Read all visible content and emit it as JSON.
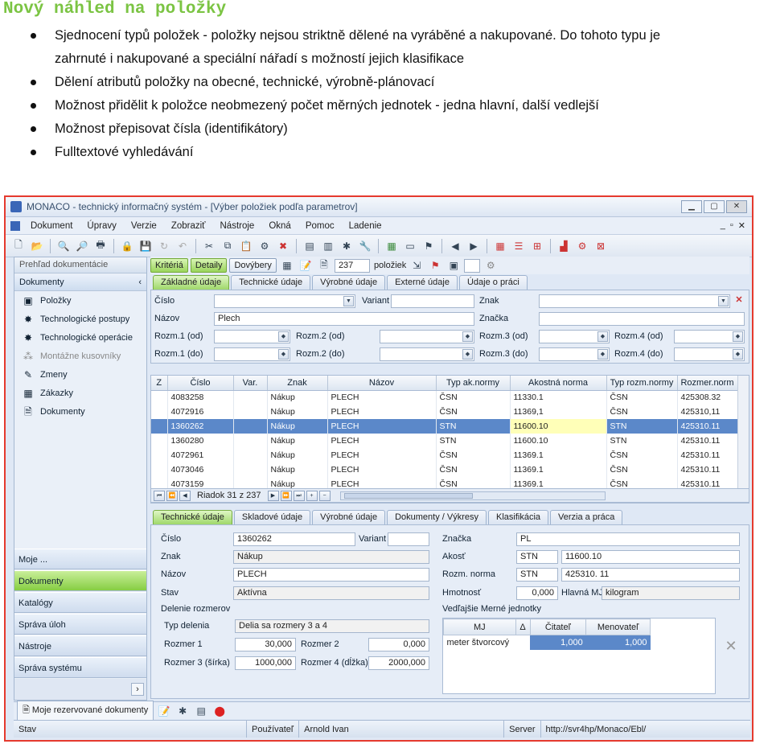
{
  "slide": {
    "title": "Nový náhled na položky",
    "bullets": [
      [
        "Sjednocení typů položek  - položky nejsou striktně dělené na vyráběné a nakupované. Do tohoto  typu je",
        "zahrnuté i nakupované a speciální nářadí s možností jejich klasifikace"
      ],
      [
        "Dělení atributů položky na obecné, technické, výrobně-plánovací"
      ],
      [
        "Možnost přidělit k položce neobmezený počet měrných jednotek  - jedna hlavní, další vedlejší"
      ],
      [
        "Možnost přepisovat čísla (identifikátory)"
      ],
      [
        "Fulltextové vyhledávání"
      ]
    ]
  },
  "window": {
    "title": "MONACO - technický informačný systém - [Výber položiek podľa parametrov]",
    "menu": [
      "Dokument",
      "Úpravy",
      "Verzie",
      "Zobraziť",
      "Nástroje",
      "Okná",
      "Pomoc",
      "Ladenie"
    ],
    "menu_right": [
      "_",
      "▫",
      "✕"
    ]
  },
  "left": {
    "header": "Prehľad dokumentácie",
    "section": "Dokumenty",
    "items": [
      {
        "label": "Položky",
        "icon": "item-icon"
      },
      {
        "label": "Technologické postupy",
        "icon": "gears-icon"
      },
      {
        "label": "Technologické operácie",
        "icon": "gears-icon"
      },
      {
        "label": "Montážne kusovníky",
        "icon": "assembly-icon"
      },
      {
        "label": "Zmeny",
        "icon": "change-icon"
      },
      {
        "label": "Zákazky",
        "icon": "order-icon"
      },
      {
        "label": "Dokumenty",
        "icon": "document-icon"
      }
    ],
    "nav": [
      "Moje ...",
      "Dokumenty",
      "Katalógy",
      "Správa úloh",
      "Nástroje",
      "Správa systému"
    ]
  },
  "topbar": {
    "kriteria": "Kritériá",
    "detaily": "Detaily",
    "dovybery": "Dovýbery",
    "count": "237",
    "count_label": "položiek"
  },
  "filter_tabs": [
    "Základné údaje",
    "Technické údaje",
    "Výrobné údaje",
    "Externé údaje",
    "Údaje o práci"
  ],
  "filter": {
    "cislo": "Číslo",
    "variant": "Variant",
    "znak": "Znak",
    "nazov": "Názov",
    "nazov_value": "Plech",
    "znacka": "Značka",
    "rozm1od": "Rozm.1 (od)",
    "rozm2od": "Rozm.2 (od)",
    "rozm3od": "Rozm.3 (od)",
    "rozm4od": "Rozm.4 (od)",
    "rozm1do": "Rozm.1 (do)",
    "rozm2do": "Rozm.2 (do)",
    "rozm3do": "Rozm.3 (do)",
    "rozm4do": "Rozm.4 (do)"
  },
  "grid": {
    "columns": [
      "Z",
      "Číslo",
      "Var.",
      "Znak",
      "Názov",
      "Typ ak.normy",
      "Akostná norma",
      "Typ rozm.normy",
      "Rozmer.norm"
    ],
    "rows": [
      [
        "",
        "4083258",
        "",
        "Nákup",
        "PLECH",
        "ČSN",
        "11330.1",
        "ČSN",
        "425308.32"
      ],
      [
        "",
        "4072916",
        "",
        "Nákup",
        "PLECH",
        "ČSN",
        "11369,1",
        "ČSN",
        "425310,11"
      ],
      [
        "",
        "1360262",
        "",
        "Nákup",
        "PLECH",
        "STN",
        "11600.10",
        "STN",
        "425310.11"
      ],
      [
        "",
        "1360280",
        "",
        "Nákup",
        "PLECH",
        "STN",
        "11600.10",
        "STN",
        "425310.11"
      ],
      [
        "",
        "4072961",
        "",
        "Nákup",
        "PLECH",
        "ČSN",
        "11369.1",
        "ČSN",
        "425310.11"
      ],
      [
        "",
        "4073046",
        "",
        "Nákup",
        "PLECH",
        "ČSN",
        "11369.1",
        "ČSN",
        "425310.11"
      ],
      [
        "",
        "4073159",
        "",
        "Nákup",
        "PLECH",
        "ČSN",
        "11369.1",
        "ČSN",
        "425310.11"
      ]
    ],
    "selected_index": 2,
    "nav_text": "Riadok 31 z 237"
  },
  "detail_tabs": [
    "Technické údaje",
    "Skladové údaje",
    "Výrobné údaje",
    "Dokumenty / Výkresy",
    "Klasifikácia",
    "Verzia a práca"
  ],
  "detail": {
    "cislo_l": "Číslo",
    "cislo": "1360262",
    "variant_l": "Variant",
    "znak_l": "Znak",
    "znak": "Nákup",
    "nazov_l": "Názov",
    "nazov": "PLECH",
    "stav_l": "Stav",
    "stav": "Aktívna",
    "delenie": "Delenie rozmerov",
    "typ_l": "Typ delenia",
    "typ": "Delia sa rozmery 3 a 4",
    "r1_l": "Rozmer 1",
    "r1": "30,000",
    "r2_l": "Rozmer 2",
    "r2": "0,000",
    "r3_l": "Rozmer 3 (šírka)",
    "r3": "1000,000",
    "r4_l": "Rozmer 4 (dĺžka)",
    "r4": "2000,000",
    "znacka_l": "Značka",
    "znacka": "PL",
    "akost_l": "Akosť",
    "akost1": "STN",
    "akost2": "11600.10",
    "rozm_l": "Rozm. norma",
    "rozm1": "STN",
    "rozm2": "425310. 11",
    "hmot_l": "Hmotnosť",
    "hmot": "0,000",
    "hmj_l": "Hlavná MJ",
    "hmj": "kilogram",
    "vmj": "Vedľajšie Merné jednotky",
    "mj_cols": [
      "MJ",
      "Δ",
      "Čitateľ",
      "Menovateľ"
    ],
    "mj_row": [
      "meter štvorcový",
      "1,000",
      "1,000"
    ]
  },
  "bottom": {
    "tab": "Moje rezervované dokumenty"
  },
  "status": {
    "stav": "Stav",
    "pouzivatel_l": "Používateľ",
    "pouzivatel": "Arnold Ivan",
    "server_l": "Server",
    "server": "http://svr4hp/Monaco/Ebl/"
  },
  "colors": {
    "title_green": "#7bc443",
    "frame_red": "#e53a2e",
    "select_blue": "#5b88c9",
    "active_green": "#9fd86a"
  }
}
